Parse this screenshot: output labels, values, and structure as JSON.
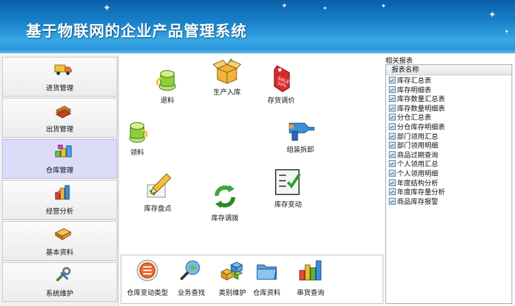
{
  "header": {
    "title": "基于物联网的企业产品管理系统"
  },
  "leftnav": {
    "items": [
      {
        "label": "进货管理",
        "icon": "truck-icon",
        "active": false
      },
      {
        "label": "出货管理",
        "icon": "books-icon",
        "active": false
      },
      {
        "label": "仓库管理",
        "icon": "warehouse-blocks-icon",
        "active": true
      },
      {
        "label": "经营分析",
        "icon": "bar-chart-icon",
        "active": false
      },
      {
        "label": "基本资料",
        "icon": "book-icon",
        "active": false
      },
      {
        "label": "系统维护",
        "icon": "wrench-icon",
        "active": false
      }
    ]
  },
  "main": {
    "functions": [
      {
        "label": "退料",
        "icon": "return-material-icon"
      },
      {
        "label": "生产入库",
        "icon": "open-box-icon"
      },
      {
        "label": "存货调价",
        "icon": "price-tag-icon"
      },
      {
        "label": "领料",
        "icon": "receive-material-icon"
      },
      {
        "label": "组装拆卸",
        "icon": "drill-icon"
      },
      {
        "label": "库存盘点",
        "icon": "pencil-check-icon"
      },
      {
        "label": "库存调拨",
        "icon": "recycle-arrows-icon"
      },
      {
        "label": "库存变动",
        "icon": "checklist-board-icon"
      }
    ]
  },
  "bottom": {
    "tools": [
      {
        "label": "仓库变动类型",
        "icon": "type-disc-icon"
      },
      {
        "label": "业务查找",
        "icon": "magnifier-globe-icon"
      },
      {
        "label": "类别维护",
        "icon": "cubes-icon"
      },
      {
        "label": "仓库资料",
        "icon": "folder-icon"
      },
      {
        "label": "串货查询",
        "icon": "column-chart-icon"
      }
    ]
  },
  "reports": {
    "section_title": "相关报表",
    "column_header": "报表名称",
    "items": [
      "库存汇总表",
      "库存明细表",
      "库存数量汇总表",
      "库存数量明细表",
      "分仓汇总表",
      "分仓库存明细表",
      "部门领用汇总",
      "部门领用明细",
      "商品过期查询",
      "个人领用汇总",
      "个人领用明细",
      "年度结构分析",
      "年度库存量分析",
      "商品库存报警"
    ]
  }
}
